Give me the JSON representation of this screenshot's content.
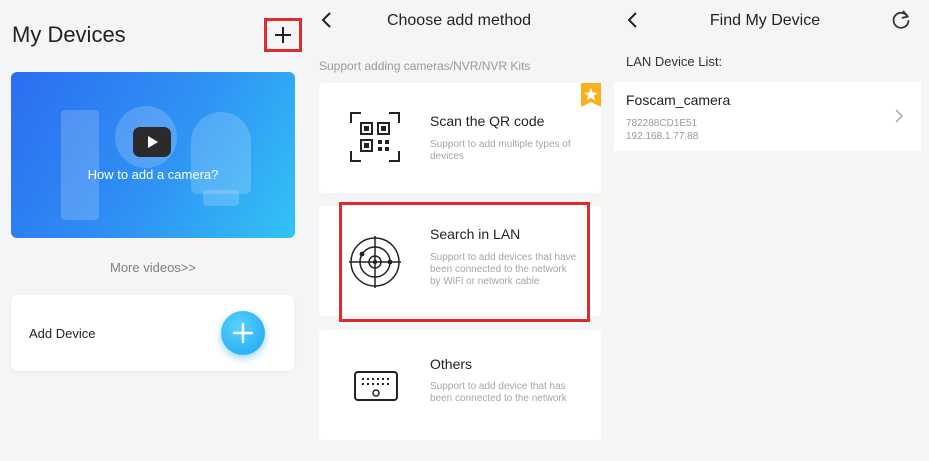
{
  "my_devices": {
    "title": "My Devices",
    "banner_text": "How to add a camera?",
    "more_videos": "More videos>>",
    "add_device_label": "Add Device"
  },
  "choose_method": {
    "title": "Choose add method",
    "subtitle": "Support adding cameras/NVR/NVR Kits",
    "methods": [
      {
        "title": "Scan the QR code",
        "desc": "Support to add multiple types of devices",
        "icon": "qr-code-icon"
      },
      {
        "title": "Search in LAN",
        "desc": "Support to add devices that have been connected to the network by WiFi or network cable",
        "icon": "radar-icon"
      },
      {
        "title": "Others",
        "desc": "Support to add device that has been connected to the network",
        "icon": "device-icon"
      }
    ]
  },
  "find_device": {
    "title": "Find My Device",
    "section_label": "LAN Device List:",
    "devices": [
      {
        "name": "Foscam_camera",
        "id": "782288CD1E51",
        "ip": "192.168.1.77:88"
      }
    ]
  },
  "colors": {
    "highlight": "#e02b2b",
    "accent": "#1aa6f0",
    "banner_start": "#2c6df1",
    "banner_end": "#33c3f6"
  }
}
